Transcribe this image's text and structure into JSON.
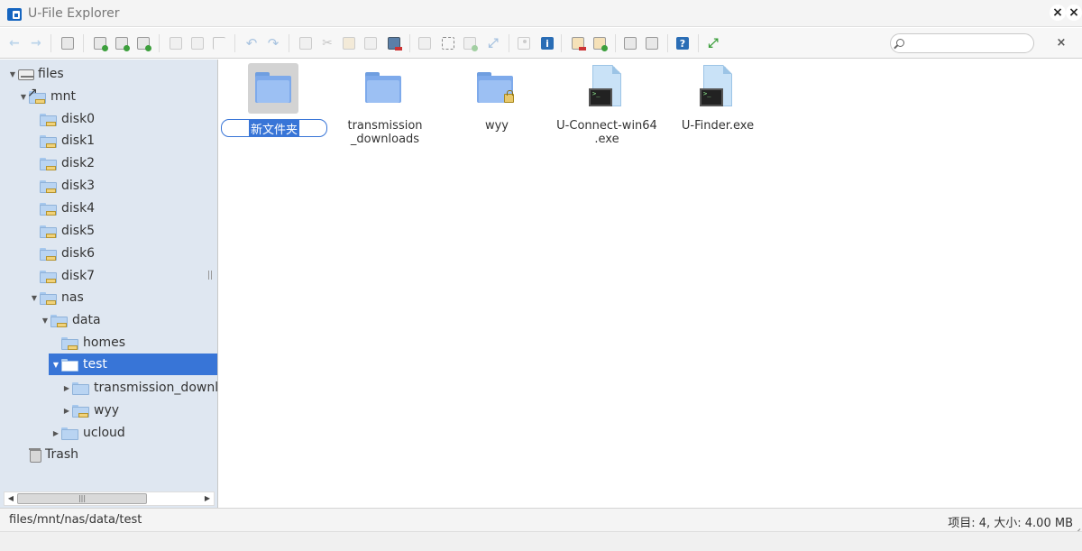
{
  "window": {
    "title": "U-File Explorer",
    "close_glyph": "×",
    "fullscreen_glyph": "×"
  },
  "toolbar": {
    "search_placeholder": "",
    "close_glyph": "×",
    "info_glyph": "i",
    "help_glyph": "?",
    "buttons": [
      "back-icon",
      "forward-icon",
      "netmount-icon",
      "upload-icon",
      "mkfile-icon",
      "save-icon",
      "open-icon",
      "download-icon",
      "select-icon",
      "undo-icon",
      "redo-icon",
      "copy-icon",
      "cut-icon",
      "paste-icon",
      "duplicate-icon",
      "delete-icon",
      "empty-icon",
      "select-all-icon",
      "rename-icon",
      "resize-icon",
      "preview-icon",
      "info-icon",
      "extract-icon",
      "archive-icon",
      "view-icon",
      "sort-icon",
      "help-icon",
      "fullscreen-icon"
    ]
  },
  "tree": [
    {
      "label": "files",
      "icon": "drive-icon",
      "expanded": true
    },
    {
      "label": "mnt",
      "icon": "mount-icon",
      "expanded": true
    },
    {
      "label": "disk0",
      "icon": "folder-icon"
    },
    {
      "label": "disk1",
      "icon": "folder-icon"
    },
    {
      "label": "disk2",
      "icon": "folder-icon"
    },
    {
      "label": "disk3",
      "icon": "folder-icon"
    },
    {
      "label": "disk4",
      "icon": "folder-icon"
    },
    {
      "label": "disk5",
      "icon": "folder-icon"
    },
    {
      "label": "disk6",
      "icon": "folder-icon"
    },
    {
      "label": "disk7",
      "icon": "folder-icon"
    },
    {
      "label": "nas",
      "icon": "folder-icon",
      "expanded": true
    },
    {
      "label": "data",
      "icon": "folder-icon",
      "expanded": true
    },
    {
      "label": "homes",
      "icon": "folder-icon"
    },
    {
      "label": "test",
      "icon": "folder-open-icon",
      "expanded": true,
      "selected": true
    },
    {
      "label": "transmission_downloa",
      "icon": "folder-icon",
      "collapsed": true
    },
    {
      "label": "wyy",
      "icon": "folder-icon",
      "collapsed": true
    },
    {
      "label": "ucloud",
      "icon": "folder-icon",
      "collapsed": true
    },
    {
      "label": "Trash",
      "icon": "trash-icon"
    }
  ],
  "sidebar_scroll": {
    "left_glyph": "◀",
    "right_glyph": "▶",
    "thumb_glyph": "|||",
    "twisty_open": "▼",
    "twisty_closed": "▶"
  },
  "files": [
    {
      "name": "新文件夹",
      "type": "folder",
      "selected": true,
      "editing": true
    },
    {
      "name": "transmission\n_downloads",
      "type": "folder"
    },
    {
      "name": "wyy",
      "type": "folder-locked"
    },
    {
      "name": "U-Connect-win64\n.exe",
      "type": "exe"
    },
    {
      "name": "U-Finder.exe",
      "type": "exe"
    }
  ],
  "statusbar": {
    "path": "files/mnt/nas/data/test",
    "stats": "项目: 4, 大小: 4.00 MB"
  }
}
